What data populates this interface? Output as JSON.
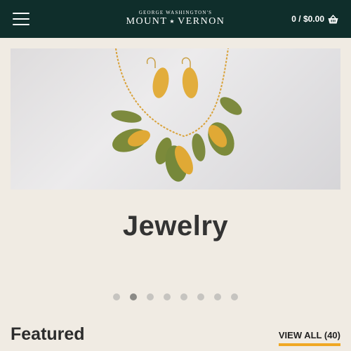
{
  "header": {
    "logo_top": "GEORGE WASHINGTON'S",
    "logo_left": "MOUNT",
    "logo_star": "★",
    "logo_right": "VERNON",
    "cart_text": "0 / $0.00",
    "menu_icon": "hamburger-icon",
    "cart_icon": "basket-icon"
  },
  "carousel": {
    "slide_title": "Jewelry",
    "slide_count": 8,
    "active_index": 1
  },
  "section": {
    "title": "Featured",
    "view_all": "VIEW ALL (40)"
  },
  "colors": {
    "header_bg": "#0f2e2b",
    "page_bg": "#f0ebe3",
    "accent": "#f0a823"
  }
}
